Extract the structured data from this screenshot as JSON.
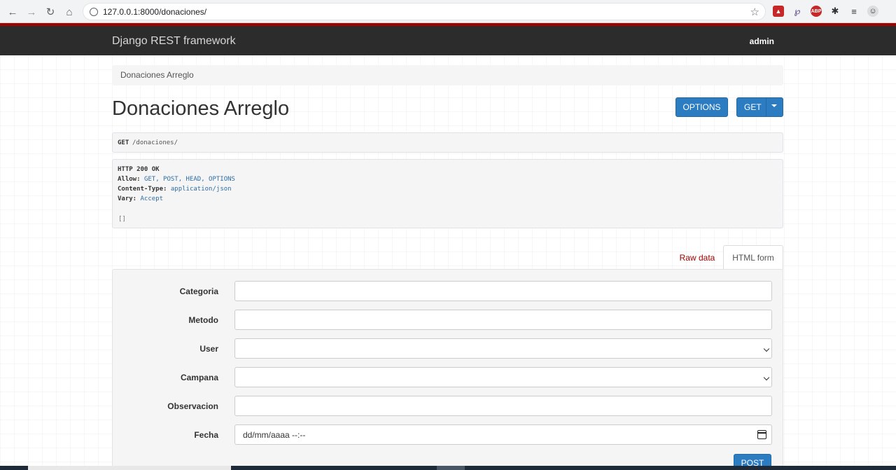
{
  "browser": {
    "url": "127.0.0.1:8000/donaciones/",
    "extensions": [
      "pdf-icon",
      "pencil-icon",
      "abp-icon",
      "puzzle-icon",
      "playlist-icon",
      "profile-icon"
    ],
    "abp_label": "ABP"
  },
  "navbar": {
    "brand": "Django REST framework",
    "user": "admin"
  },
  "breadcrumb": {
    "current": "Donaciones Arreglo"
  },
  "page": {
    "title": "Donaciones Arreglo",
    "options_button": "OPTIONS",
    "get_button": "GET"
  },
  "request": {
    "method": "GET",
    "path": "/donaciones/"
  },
  "response": {
    "status": "HTTP 200 OK",
    "headers": [
      {
        "key": "Allow:",
        "value": "GET, POST, HEAD, OPTIONS"
      },
      {
        "key": "Content-Type:",
        "value": "application/json"
      },
      {
        "key": "Vary:",
        "value": "Accept"
      }
    ],
    "body": "[]"
  },
  "tabs": {
    "raw": "Raw data",
    "html": "HTML form"
  },
  "form": {
    "fields": [
      {
        "label": "Categoria",
        "type": "text",
        "value": ""
      },
      {
        "label": "Metodo",
        "type": "text",
        "value": ""
      },
      {
        "label": "User",
        "type": "select",
        "value": ""
      },
      {
        "label": "Campana",
        "type": "select",
        "value": ""
      },
      {
        "label": "Observacion",
        "type": "text",
        "value": ""
      },
      {
        "label": "Fecha",
        "type": "datetime",
        "value": "dd/mm/aaaa --:--"
      }
    ],
    "submit": "POST"
  }
}
